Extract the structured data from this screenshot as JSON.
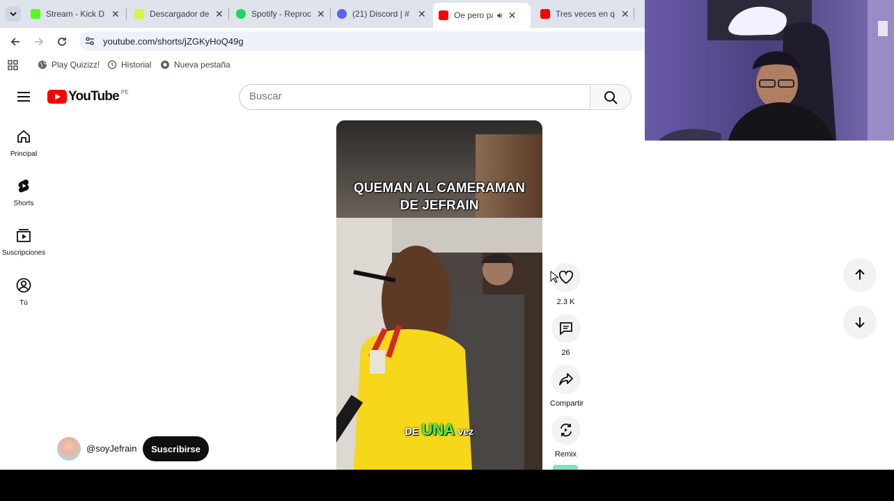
{
  "browser": {
    "tabs": [
      {
        "title": "Stream - Kick D",
        "color": "#53fc18",
        "active": false
      },
      {
        "title": "Descargador de",
        "color": "#d7f542",
        "active": false
      },
      {
        "title": "Spotify - Reproc",
        "color": "#1ed760",
        "active": false
      },
      {
        "title": "(21) Discord | #",
        "color": "#5865f2",
        "active": false
      },
      {
        "title": "Oe pero pa",
        "color": "#ff0000",
        "active": true
      },
      {
        "title": "Tres veces en q",
        "color": "#ff0000",
        "active": false
      }
    ],
    "url": "youtube.com/shorts/jZGKyHoQ49g",
    "bookmarks": [
      "Play Quizizz!",
      "Historial",
      "Nueva pestaña"
    ]
  },
  "youtube": {
    "logo_text": "YouTube",
    "country_code": "PE",
    "search_placeholder": "Buscar",
    "sidebar": [
      {
        "label": "Principal",
        "icon": "home-icon"
      },
      {
        "label": "Shorts",
        "icon": "shorts-icon"
      },
      {
        "label": "Suscripciones",
        "icon": "subscriptions-icon"
      },
      {
        "label": "Tú",
        "icon": "account-icon"
      }
    ],
    "video": {
      "caption_line1": "QUEMAN AL CAMERAMAN",
      "caption_line2": "DE JEFRAIN",
      "subtitle_pre": "DE",
      "subtitle_highlight": "UNA",
      "subtitle_post": "vez",
      "highlight_color": "#39ff5a"
    },
    "actions": {
      "like_count": "2.3 K",
      "comment_count": "26",
      "share_label": "Compartir",
      "remix_label": "Remix"
    },
    "channel": {
      "handle": "@soyJefrain",
      "subscribe_label": "Suscribirse"
    }
  }
}
